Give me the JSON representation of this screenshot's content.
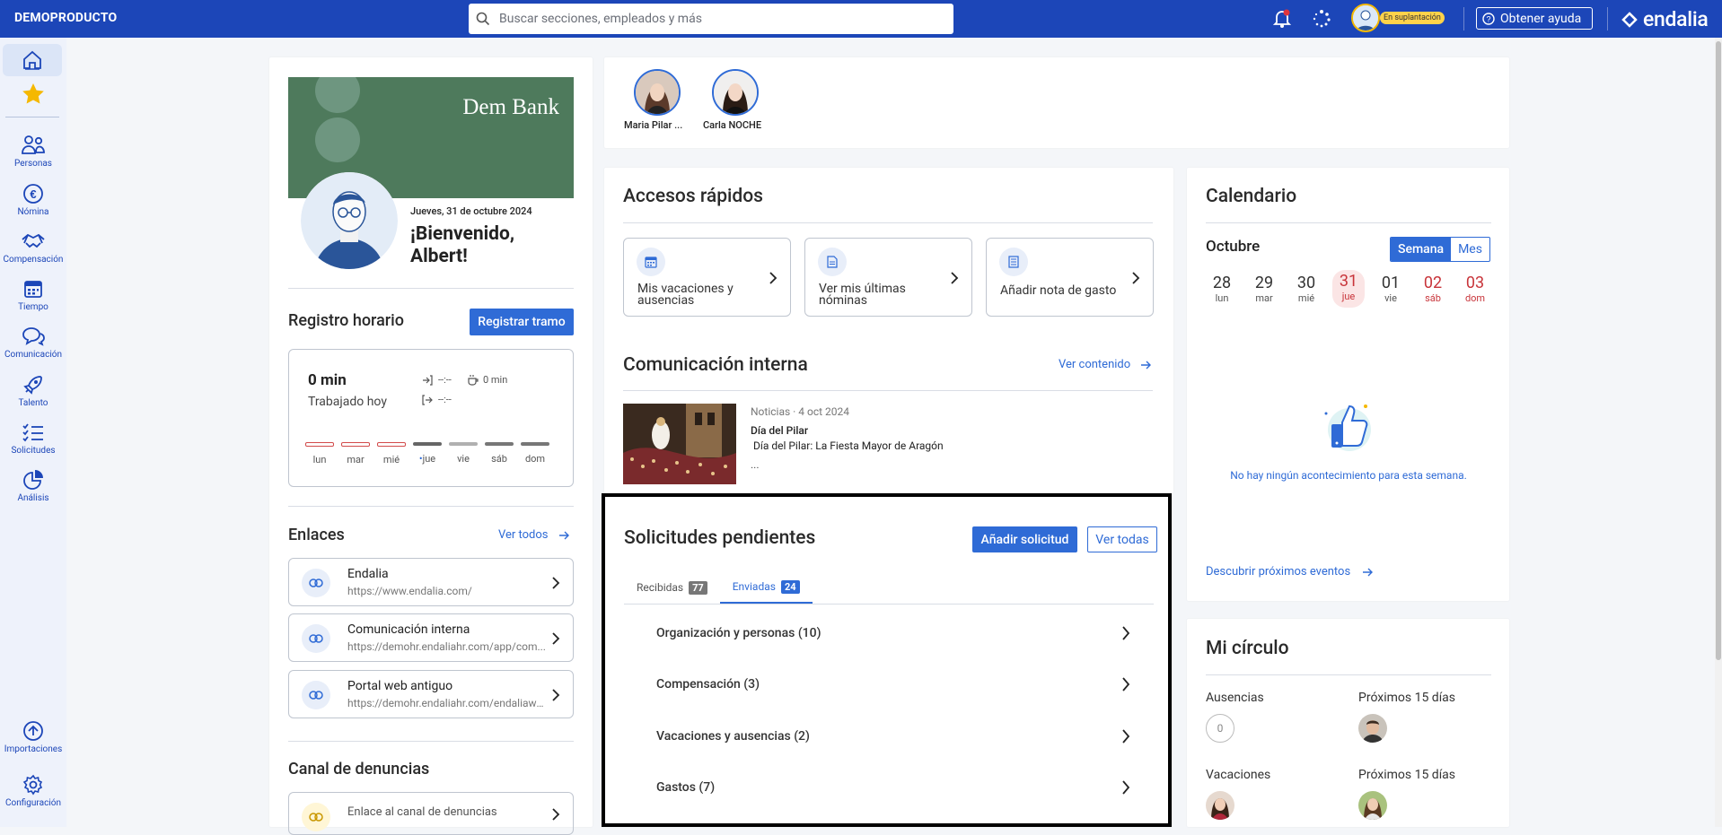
{
  "topbar": {
    "brand": "DEMOPRODUCTO",
    "search_placeholder": "Buscar secciones, empleados y más",
    "impersonation_badge": "En suplantación",
    "help_label": "Obtener ayuda",
    "logo_text": "endalia"
  },
  "rail": {
    "items": [
      {
        "label": "Personas",
        "icon": "people-icon"
      },
      {
        "label": "Nómina",
        "icon": "euro-icon"
      },
      {
        "label": "Compensación",
        "icon": "handshake-icon"
      },
      {
        "label": "Tiempo",
        "icon": "calendar-icon"
      },
      {
        "label": "Comunicación",
        "icon": "chat-icon"
      },
      {
        "label": "Talento",
        "icon": "rocket-icon"
      },
      {
        "label": "Solicitudes",
        "icon": "checklist-icon"
      },
      {
        "label": "Análisis",
        "icon": "pie-chart-icon"
      }
    ],
    "bottom": [
      {
        "label": "Importaciones",
        "icon": "upload-icon"
      },
      {
        "label": "Configuración",
        "icon": "gear-icon"
      }
    ]
  },
  "welcome": {
    "bank_logo": "Dem Bank",
    "date": "Jueves, 31 de octubre 2024",
    "greeting": "¡Bienvenido, Albert!"
  },
  "registro": {
    "title": "Registro horario",
    "button": "Registrar tramo",
    "worked": "0 min",
    "worked_label": "Trabajado hoy",
    "in_time": "--:--",
    "out_time": "--:--",
    "break_time": "0 min",
    "days": [
      "lun",
      "mar",
      "mié",
      "jue",
      "vie",
      "sáb",
      "dom"
    ]
  },
  "enlaces": {
    "title": "Enlaces",
    "see_all": "Ver todos",
    "items": [
      {
        "title": "Endalia",
        "url": "https://www.endalia.com/"
      },
      {
        "title": "Comunicación interna",
        "url": "https://demohr.endaliahr.com/app/com..."
      },
      {
        "title": "Portal web antiguo",
        "url": "https://demohr.endaliahr.com/endaliawe..."
      }
    ]
  },
  "denuncias": {
    "title": "Canal de denuncias",
    "link": "Enlace al canal de denuncias"
  },
  "people_strip": [
    {
      "name": "Maria Pilar ..."
    },
    {
      "name": "Carla NOCHE"
    }
  ],
  "accesos": {
    "title": "Accesos rápidos",
    "items": [
      {
        "label": "Mis vacaciones y ausencias",
        "icon": "calendar-icon"
      },
      {
        "label": "Ver mis últimas nóminas",
        "icon": "document-icon"
      },
      {
        "label": "Añadir nota de gasto",
        "icon": "receipt-icon"
      }
    ]
  },
  "comunicacion": {
    "title": "Comunicación interna",
    "see_content": "Ver contenido",
    "meta": "Noticias · 4 oct 2024",
    "headline": "Día del Pilar",
    "subtitle": " Día del Pilar: La Fiesta Mayor de Aragón",
    "ellipsis": "..."
  },
  "solicitudes": {
    "title": "Solicitudes pendientes",
    "add_button": "Añadir solicitud",
    "see_all": "Ver todas",
    "tabs": [
      {
        "label": "Recibidas",
        "count": "77"
      },
      {
        "label": "Enviadas",
        "count": "24"
      }
    ],
    "items": [
      {
        "label": "Organización y personas (10)"
      },
      {
        "label": "Compensación (3)"
      },
      {
        "label": "Vacaciones y ausencias (2)"
      },
      {
        "label": "Gastos (7)"
      }
    ]
  },
  "calendario": {
    "title": "Calendario",
    "month": "Octubre",
    "view_week": "Semana",
    "view_month": "Mes",
    "days": [
      {
        "n": "28",
        "l": "lun"
      },
      {
        "n": "29",
        "l": "mar"
      },
      {
        "n": "30",
        "l": "mié"
      },
      {
        "n": "31",
        "l": "jue"
      },
      {
        "n": "01",
        "l": "vie"
      },
      {
        "n": "02",
        "l": "sáb"
      },
      {
        "n": "03",
        "l": "dom"
      }
    ],
    "empty": "No hay ningún acontecimiento para esta semana.",
    "discover": "Descubrir próximos eventos"
  },
  "circulo": {
    "title": "Mi círculo",
    "ausencias": "Ausencias",
    "ausencias_count": "0",
    "proximos": "Próximos 15 días",
    "vacaciones": "Vacaciones",
    "proximos2": "Próximos 15 días"
  },
  "colors": {
    "brand_blue": "#1c46b8",
    "accent": "#2f6bd6",
    "today": "#c8343a",
    "bank_green": "#4e7a5c"
  }
}
